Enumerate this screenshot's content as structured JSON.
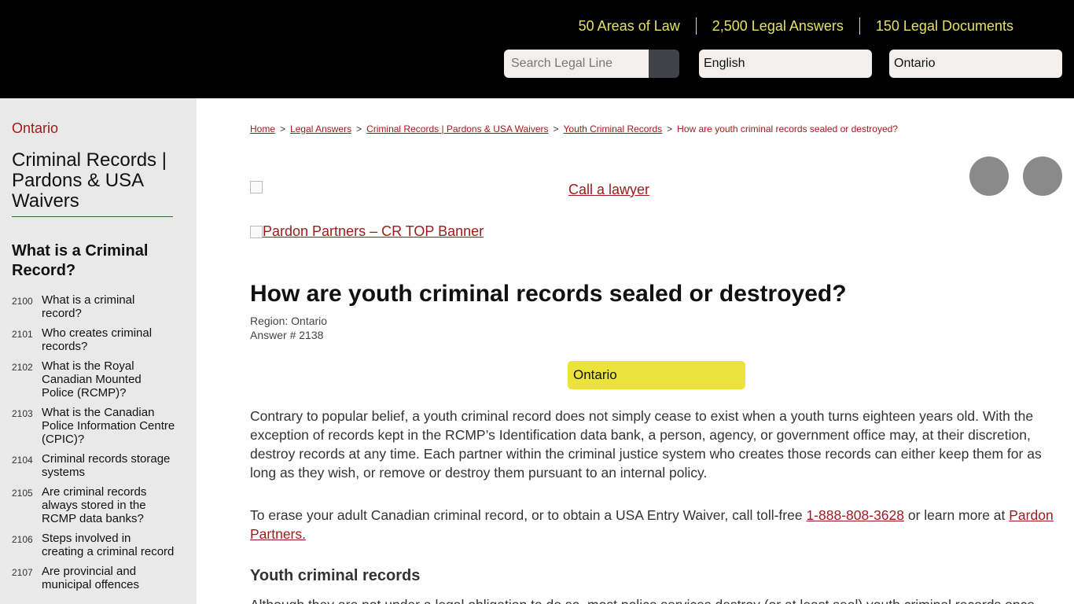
{
  "header": {
    "stats": [
      "50 Areas of Law",
      "2,500 Legal Answers",
      "150 Legal Documents"
    ],
    "search_placeholder": "Search Legal Line",
    "language": "English",
    "region": "Ontario"
  },
  "sidebar": {
    "region": "Ontario",
    "category": "Criminal Records | Pardons & USA Waivers",
    "section": "What is a Criminal Record?",
    "items": [
      {
        "num": "2100",
        "label": "What is a criminal record?"
      },
      {
        "num": "2101",
        "label": "Who creates criminal records?"
      },
      {
        "num": "2102",
        "label": "What is the Royal Canadian Mounted Police (RCMP)?"
      },
      {
        "num": "2103",
        "label": "What is the Canadian Police Information Centre (CPIC)?"
      },
      {
        "num": "2104",
        "label": "Criminal records storage systems"
      },
      {
        "num": "2105",
        "label": "Are criminal records always stored in the RCMP data banks?"
      },
      {
        "num": "2106",
        "label": "Steps involved in creating a criminal record"
      },
      {
        "num": "2107",
        "label": "Are provincial and municipal offences"
      }
    ]
  },
  "breadcrumb": {
    "items": [
      "Home",
      "Legal Answers",
      "Criminal Records | Pardons & USA Waivers",
      "Youth Criminal Records"
    ],
    "separator": ">",
    "current": "How are youth criminal records sealed or destroyed?"
  },
  "main": {
    "call_lawyer": "Call a lawyer",
    "banner_alt": "Pardon Partners – CR TOP Banner",
    "title": "How are youth criminal records sealed or destroyed?",
    "region_line": "Region: Ontario",
    "answer_line": "Answer # 2138",
    "region_pill": "Ontario",
    "para1": "Contrary to popular belief, a youth criminal record does not simply cease to exist when a youth turns eighteen years old. With the exception of records kept in the RCMP’s Identification data bank, a person, agency, or government office may, at their discretion, destroy records at any time. Each partner within the criminal justice system who creates those records can either keep them for as long as they wish, or remove or destroy them pursuant to an internal policy.",
    "para2_before": "To erase your adult Canadian criminal record, or to obtain a USA Entry Waiver, call toll-free ",
    "para2_phone": "1-888-808-3628",
    "para2_middle": " or learn more at ",
    "para2_link": "Pardon Partners.",
    "section_heading": "Youth criminal records",
    "para3": "Although they are not under a legal obligation to do so, most police services destroy (or at least seal) youth criminal records once"
  },
  "colors": {
    "header_bg": "#000000",
    "stats_text": "#e7e161",
    "link_red": "#a11a1a",
    "pill_yellow": "#ece23c",
    "sidebar_bg": "#e9e9e9"
  }
}
